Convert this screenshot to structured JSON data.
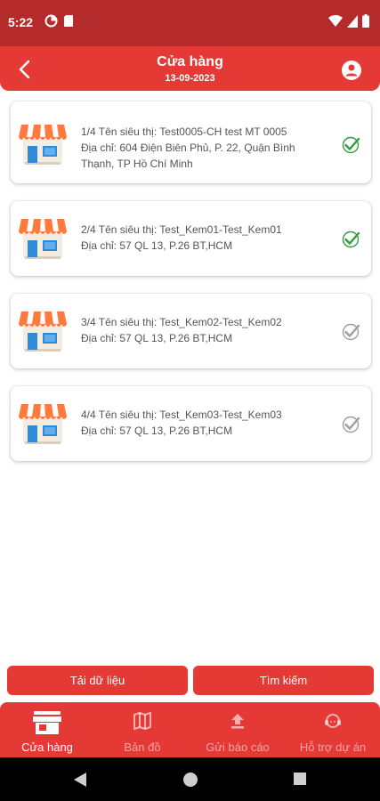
{
  "status_bar": {
    "time": "5:22"
  },
  "header": {
    "title": "Cửa hàng",
    "date": "13-09-2023"
  },
  "stores": [
    {
      "line1": "1/4 Tên siêu thị: Test0005-CH test MT 0005",
      "line2": "Địa chỉ: 604 Điện Biên Phủ, P. 22, Quận Bình Thạnh, TP Hồ Chí Minh",
      "done": true
    },
    {
      "line1": "2/4 Tên siêu thị: Test_Kem01-Test_Kem01",
      "line2": "Địa chỉ: 57 QL 13, P.26 BT,HCM",
      "done": true
    },
    {
      "line1": "3/4 Tên siêu thị: Test_Kem02-Test_Kem02",
      "line2": "Địa chỉ: 57 QL 13, P.26 BT,HCM",
      "done": false
    },
    {
      "line1": "4/4 Tên siêu thị: Test_Kem03-Test_Kem03",
      "line2": "Địa chỉ: 57 QL 13, P.26 BT,HCM",
      "done": false
    }
  ],
  "actions": {
    "load_label": "Tải dữ liệu",
    "search_label": "Tìm kiếm"
  },
  "tabs": [
    {
      "label": "Cửa hàng",
      "icon": "store-icon",
      "active": true
    },
    {
      "label": "Bản đồ",
      "icon": "map-icon",
      "active": false
    },
    {
      "label": "Gửi báo cáo",
      "icon": "upload-icon",
      "active": false
    },
    {
      "label": "Hỗ trợ dự án",
      "icon": "support-icon",
      "active": false
    }
  ],
  "colors": {
    "primary": "#e53935",
    "status_bar": "#b52a2a",
    "check_done": "#2e9e3e",
    "check_pending": "#9e9e9e"
  }
}
